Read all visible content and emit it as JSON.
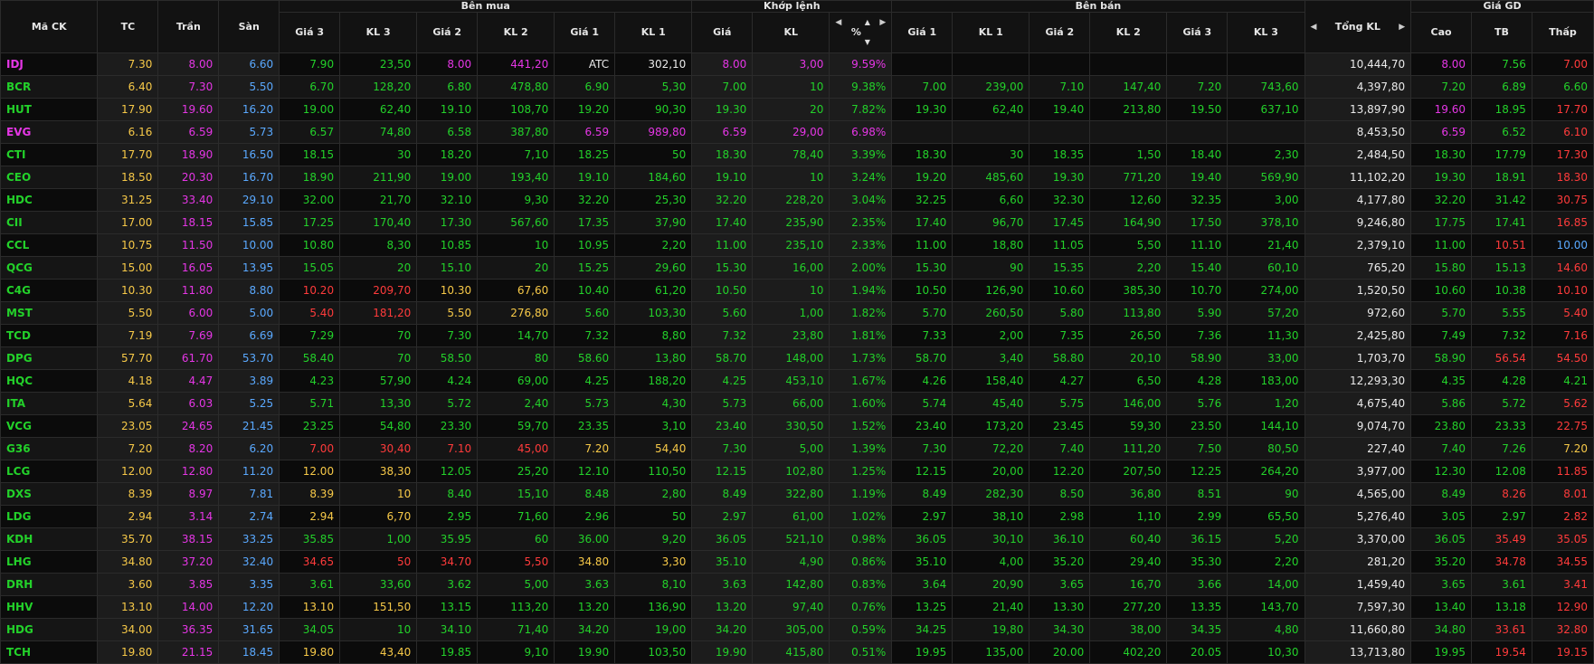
{
  "header": {
    "symbol": "Mã CK",
    "ref": "TC",
    "ceiling": "Trần",
    "floor": "Sàn",
    "buy_group": "Bên mua",
    "match_group": "Khớp lệnh",
    "sell_group": "Bên bán",
    "total_vol": "Tổng KL",
    "session_group": "Giá GD",
    "buy_cols": [
      "Giá 3",
      "KL 3",
      "Giá 2",
      "KL 2",
      "Giá 1",
      "KL 1"
    ],
    "match_cols": [
      "Giá",
      "KL",
      "%"
    ],
    "sell_cols": [
      "Giá 1",
      "KL 1",
      "Giá 2",
      "KL 2",
      "Giá 3",
      "KL 3"
    ],
    "session_cols": [
      "Cao",
      "TB",
      "Thấp"
    ]
  },
  "colors": {
    "up": "#23d12a",
    "down": "#ff3b3b",
    "ref": "#f7c948",
    "ceiling": "#e536e5",
    "floor": "#5aa9ff",
    "white": "#eaeaea"
  },
  "rows": [
    {
      "s": "IDJ",
      "tc": "7.30",
      "ce": "8.00",
      "fl": "6.60",
      "b": [
        "7.90",
        "23,50",
        "8.00",
        "441,20",
        "ATC",
        "302,10"
      ],
      "m": [
        "8.00",
        "3,00",
        "9.59%"
      ],
      "a": [
        "",
        "",
        "",
        "",
        "",
        ""
      ],
      "tot": "10,444,70",
      "hl": [
        "8.00",
        "7.56",
        "7.00"
      ]
    },
    {
      "s": "BCR",
      "tc": "6.40",
      "ce": "7.30",
      "fl": "5.50",
      "b": [
        "6.70",
        "128,20",
        "6.80",
        "478,80",
        "6.90",
        "5,30"
      ],
      "m": [
        "7.00",
        "10",
        "9.38%"
      ],
      "a": [
        "7.00",
        "239,00",
        "7.10",
        "147,40",
        "7.20",
        "743,60"
      ],
      "tot": "4,397,80",
      "hl": [
        "7.20",
        "6.89",
        "6.60"
      ]
    },
    {
      "s": "HUT",
      "tc": "17.90",
      "ce": "19.60",
      "fl": "16.20",
      "b": [
        "19.00",
        "62,40",
        "19.10",
        "108,70",
        "19.20",
        "90,30"
      ],
      "m": [
        "19.30",
        "20",
        "7.82%"
      ],
      "a": [
        "19.30",
        "62,40",
        "19.40",
        "213,80",
        "19.50",
        "637,10"
      ],
      "tot": "13,897,90",
      "hl": [
        "19.60",
        "18.95",
        "17.70"
      ]
    },
    {
      "s": "EVG",
      "tc": "6.16",
      "ce": "6.59",
      "fl": "5.73",
      "b": [
        "6.57",
        "74,80",
        "6.58",
        "387,80",
        "6.59",
        "989,80"
      ],
      "m": [
        "6.59",
        "29,00",
        "6.98%"
      ],
      "a": [
        "",
        "",
        "",
        "",
        "",
        ""
      ],
      "tot": "8,453,50",
      "hl": [
        "6.59",
        "6.52",
        "6.10"
      ]
    },
    {
      "s": "CTI",
      "tc": "17.70",
      "ce": "18.90",
      "fl": "16.50",
      "b": [
        "18.15",
        "30",
        "18.20",
        "7,10",
        "18.25",
        "50"
      ],
      "m": [
        "18.30",
        "78,40",
        "3.39%"
      ],
      "a": [
        "18.30",
        "30",
        "18.35",
        "1,50",
        "18.40",
        "2,30"
      ],
      "tot": "2,484,50",
      "hl": [
        "18.30",
        "17.79",
        "17.30"
      ]
    },
    {
      "s": "CEO",
      "tc": "18.50",
      "ce": "20.30",
      "fl": "16.70",
      "b": [
        "18.90",
        "211,90",
        "19.00",
        "193,40",
        "19.10",
        "184,60"
      ],
      "m": [
        "19.10",
        "10",
        "3.24%"
      ],
      "a": [
        "19.20",
        "485,60",
        "19.30",
        "771,20",
        "19.40",
        "569,90"
      ],
      "tot": "11,102,20",
      "hl": [
        "19.30",
        "18.91",
        "18.30"
      ]
    },
    {
      "s": "HDC",
      "tc": "31.25",
      "ce": "33.40",
      "fl": "29.10",
      "b": [
        "32.00",
        "21,70",
        "32.10",
        "9,30",
        "32.20",
        "25,30"
      ],
      "m": [
        "32.20",
        "228,20",
        "3.04%"
      ],
      "a": [
        "32.25",
        "6,60",
        "32.30",
        "12,60",
        "32.35",
        "3,00"
      ],
      "tot": "4,177,80",
      "hl": [
        "32.20",
        "31.42",
        "30.75"
      ]
    },
    {
      "s": "CII",
      "tc": "17.00",
      "ce": "18.15",
      "fl": "15.85",
      "b": [
        "17.25",
        "170,40",
        "17.30",
        "567,60",
        "17.35",
        "37,90"
      ],
      "m": [
        "17.40",
        "235,90",
        "2.35%"
      ],
      "a": [
        "17.40",
        "96,70",
        "17.45",
        "164,90",
        "17.50",
        "378,10"
      ],
      "tot": "9,246,80",
      "hl": [
        "17.75",
        "17.41",
        "16.85"
      ]
    },
    {
      "s": "CCL",
      "tc": "10.75",
      "ce": "11.50",
      "fl": "10.00",
      "b": [
        "10.80",
        "8,30",
        "10.85",
        "10",
        "10.95",
        "2,20"
      ],
      "m": [
        "11.00",
        "235,10",
        "2.33%"
      ],
      "a": [
        "11.00",
        "18,80",
        "11.05",
        "5,50",
        "11.10",
        "21,40"
      ],
      "tot": "2,379,10",
      "hl": [
        "11.00",
        "10.51",
        "10.00"
      ]
    },
    {
      "s": "QCG",
      "tc": "15.00",
      "ce": "16.05",
      "fl": "13.95",
      "b": [
        "15.05",
        "20",
        "15.10",
        "20",
        "15.25",
        "29,60"
      ],
      "m": [
        "15.30",
        "16,00",
        "2.00%"
      ],
      "a": [
        "15.30",
        "90",
        "15.35",
        "2,20",
        "15.40",
        "60,10"
      ],
      "tot": "765,20",
      "hl": [
        "15.80",
        "15.13",
        "14.60"
      ]
    },
    {
      "s": "C4G",
      "tc": "10.30",
      "ce": "11.80",
      "fl": "8.80",
      "b": [
        "10.20",
        "209,70",
        "10.30",
        "67,60",
        "10.40",
        "61,20"
      ],
      "m": [
        "10.50",
        "10",
        "1.94%"
      ],
      "a": [
        "10.50",
        "126,90",
        "10.60",
        "385,30",
        "10.70",
        "274,00"
      ],
      "tot": "1,520,50",
      "hl": [
        "10.60",
        "10.38",
        "10.10"
      ]
    },
    {
      "s": "MST",
      "tc": "5.50",
      "ce": "6.00",
      "fl": "5.00",
      "b": [
        "5.40",
        "181,20",
        "5.50",
        "276,80",
        "5.60",
        "103,30"
      ],
      "m": [
        "5.60",
        "1,00",
        "1.82%"
      ],
      "a": [
        "5.70",
        "260,50",
        "5.80",
        "113,80",
        "5.90",
        "57,20"
      ],
      "tot": "972,60",
      "hl": [
        "5.70",
        "5.55",
        "5.40"
      ]
    },
    {
      "s": "TCD",
      "tc": "7.19",
      "ce": "7.69",
      "fl": "6.69",
      "b": [
        "7.29",
        "70",
        "7.30",
        "14,70",
        "7.32",
        "8,80"
      ],
      "m": [
        "7.32",
        "23,80",
        "1.81%"
      ],
      "a": [
        "7.33",
        "2,00",
        "7.35",
        "26,50",
        "7.36",
        "11,30"
      ],
      "tot": "2,425,80",
      "hl": [
        "7.49",
        "7.32",
        "7.16"
      ]
    },
    {
      "s": "DPG",
      "tc": "57.70",
      "ce": "61.70",
      "fl": "53.70",
      "b": [
        "58.40",
        "70",
        "58.50",
        "80",
        "58.60",
        "13,80"
      ],
      "m": [
        "58.70",
        "148,00",
        "1.73%"
      ],
      "a": [
        "58.70",
        "3,40",
        "58.80",
        "20,10",
        "58.90",
        "33,00"
      ],
      "tot": "1,703,70",
      "hl": [
        "58.90",
        "56.54",
        "54.50"
      ]
    },
    {
      "s": "HQC",
      "tc": "4.18",
      "ce": "4.47",
      "fl": "3.89",
      "b": [
        "4.23",
        "57,90",
        "4.24",
        "69,00",
        "4.25",
        "188,20"
      ],
      "m": [
        "4.25",
        "453,10",
        "1.67%"
      ],
      "a": [
        "4.26",
        "158,40",
        "4.27",
        "6,50",
        "4.28",
        "183,00"
      ],
      "tot": "12,293,30",
      "hl": [
        "4.35",
        "4.28",
        "4.21"
      ]
    },
    {
      "s": "ITA",
      "tc": "5.64",
      "ce": "6.03",
      "fl": "5.25",
      "b": [
        "5.71",
        "13,30",
        "5.72",
        "2,40",
        "5.73",
        "4,30"
      ],
      "m": [
        "5.73",
        "66,00",
        "1.60%"
      ],
      "a": [
        "5.74",
        "45,40",
        "5.75",
        "146,00",
        "5.76",
        "1,20"
      ],
      "tot": "4,675,40",
      "hl": [
        "5.86",
        "5.72",
        "5.62"
      ]
    },
    {
      "s": "VCG",
      "tc": "23.05",
      "ce": "24.65",
      "fl": "21.45",
      "b": [
        "23.25",
        "54,80",
        "23.30",
        "59,70",
        "23.35",
        "3,10"
      ],
      "m": [
        "23.40",
        "330,50",
        "1.52%"
      ],
      "a": [
        "23.40",
        "173,20",
        "23.45",
        "59,30",
        "23.50",
        "144,10"
      ],
      "tot": "9,074,70",
      "hl": [
        "23.80",
        "23.33",
        "22.75"
      ]
    },
    {
      "s": "G36",
      "tc": "7.20",
      "ce": "8.20",
      "fl": "6.20",
      "b": [
        "7.00",
        "30,40",
        "7.10",
        "45,00",
        "7.20",
        "54,40"
      ],
      "m": [
        "7.30",
        "5,00",
        "1.39%"
      ],
      "a": [
        "7.30",
        "72,20",
        "7.40",
        "111,20",
        "7.50",
        "80,50"
      ],
      "tot": "227,40",
      "hl": [
        "7.40",
        "7.26",
        "7.20"
      ]
    },
    {
      "s": "LCG",
      "tc": "12.00",
      "ce": "12.80",
      "fl": "11.20",
      "b": [
        "12.00",
        "38,30",
        "12.05",
        "25,20",
        "12.10",
        "110,50"
      ],
      "m": [
        "12.15",
        "102,80",
        "1.25%"
      ],
      "a": [
        "12.15",
        "20,00",
        "12.20",
        "207,50",
        "12.25",
        "264,20"
      ],
      "tot": "3,977,00",
      "hl": [
        "12.30",
        "12.08",
        "11.85"
      ]
    },
    {
      "s": "DXS",
      "tc": "8.39",
      "ce": "8.97",
      "fl": "7.81",
      "b": [
        "8.39",
        "10",
        "8.40",
        "15,10",
        "8.48",
        "2,80"
      ],
      "m": [
        "8.49",
        "322,80",
        "1.19%"
      ],
      "a": [
        "8.49",
        "282,30",
        "8.50",
        "36,80",
        "8.51",
        "90"
      ],
      "tot": "4,565,00",
      "hl": [
        "8.49",
        "8.26",
        "8.01"
      ]
    },
    {
      "s": "LDG",
      "tc": "2.94",
      "ce": "3.14",
      "fl": "2.74",
      "b": [
        "2.94",
        "6,70",
        "2.95",
        "71,60",
        "2.96",
        "50"
      ],
      "m": [
        "2.97",
        "61,00",
        "1.02%"
      ],
      "a": [
        "2.97",
        "38,10",
        "2.98",
        "1,10",
        "2.99",
        "65,50"
      ],
      "tot": "5,276,40",
      "hl": [
        "3.05",
        "2.97",
        "2.82"
      ]
    },
    {
      "s": "KDH",
      "tc": "35.70",
      "ce": "38.15",
      "fl": "33.25",
      "b": [
        "35.85",
        "1,00",
        "35.95",
        "60",
        "36.00",
        "9,20"
      ],
      "m": [
        "36.05",
        "521,10",
        "0.98%"
      ],
      "a": [
        "36.05",
        "30,10",
        "36.10",
        "60,40",
        "36.15",
        "5,20"
      ],
      "tot": "3,370,00",
      "hl": [
        "36.05",
        "35.49",
        "35.05"
      ]
    },
    {
      "s": "LHG",
      "tc": "34.80",
      "ce": "37.20",
      "fl": "32.40",
      "b": [
        "34.65",
        "50",
        "34.70",
        "5,50",
        "34.80",
        "3,30"
      ],
      "m": [
        "35.10",
        "4,90",
        "0.86%"
      ],
      "a": [
        "35.10",
        "4,00",
        "35.20",
        "29,40",
        "35.30",
        "2,20"
      ],
      "tot": "281,20",
      "hl": [
        "35.20",
        "34.78",
        "34.55"
      ]
    },
    {
      "s": "DRH",
      "tc": "3.60",
      "ce": "3.85",
      "fl": "3.35",
      "b": [
        "3.61",
        "33,60",
        "3.62",
        "5,00",
        "3.63",
        "8,10"
      ],
      "m": [
        "3.63",
        "142,80",
        "0.83%"
      ],
      "a": [
        "3.64",
        "20,90",
        "3.65",
        "16,70",
        "3.66",
        "14,00"
      ],
      "tot": "1,459,40",
      "hl": [
        "3.65",
        "3.61",
        "3.41"
      ]
    },
    {
      "s": "HHV",
      "tc": "13.10",
      "ce": "14.00",
      "fl": "12.20",
      "b": [
        "13.10",
        "151,50",
        "13.15",
        "113,20",
        "13.20",
        "136,90"
      ],
      "m": [
        "13.20",
        "97,40",
        "0.76%"
      ],
      "a": [
        "13.25",
        "21,40",
        "13.30",
        "277,20",
        "13.35",
        "143,70"
      ],
      "tot": "7,597,30",
      "hl": [
        "13.40",
        "13.18",
        "12.90"
      ]
    },
    {
      "s": "HDG",
      "tc": "34.00",
      "ce": "36.35",
      "fl": "31.65",
      "b": [
        "34.05",
        "10",
        "34.10",
        "71,40",
        "34.20",
        "19,00"
      ],
      "m": [
        "34.20",
        "305,00",
        "0.59%"
      ],
      "a": [
        "34.25",
        "19,80",
        "34.30",
        "38,00",
        "34.35",
        "4,80"
      ],
      "tot": "11,660,80",
      "hl": [
        "34.80",
        "33.61",
        "32.80"
      ]
    },
    {
      "s": "TCH",
      "tc": "19.80",
      "ce": "21.15",
      "fl": "18.45",
      "b": [
        "19.80",
        "43,40",
        "19.85",
        "9,10",
        "19.90",
        "103,50"
      ],
      "m": [
        "19.90",
        "415,80",
        "0.51%"
      ],
      "a": [
        "19.95",
        "135,00",
        "20.00",
        "402,20",
        "20.05",
        "10,30"
      ],
      "tot": "13,713,80",
      "hl": [
        "19.95",
        "19.54",
        "19.15"
      ]
    }
  ]
}
